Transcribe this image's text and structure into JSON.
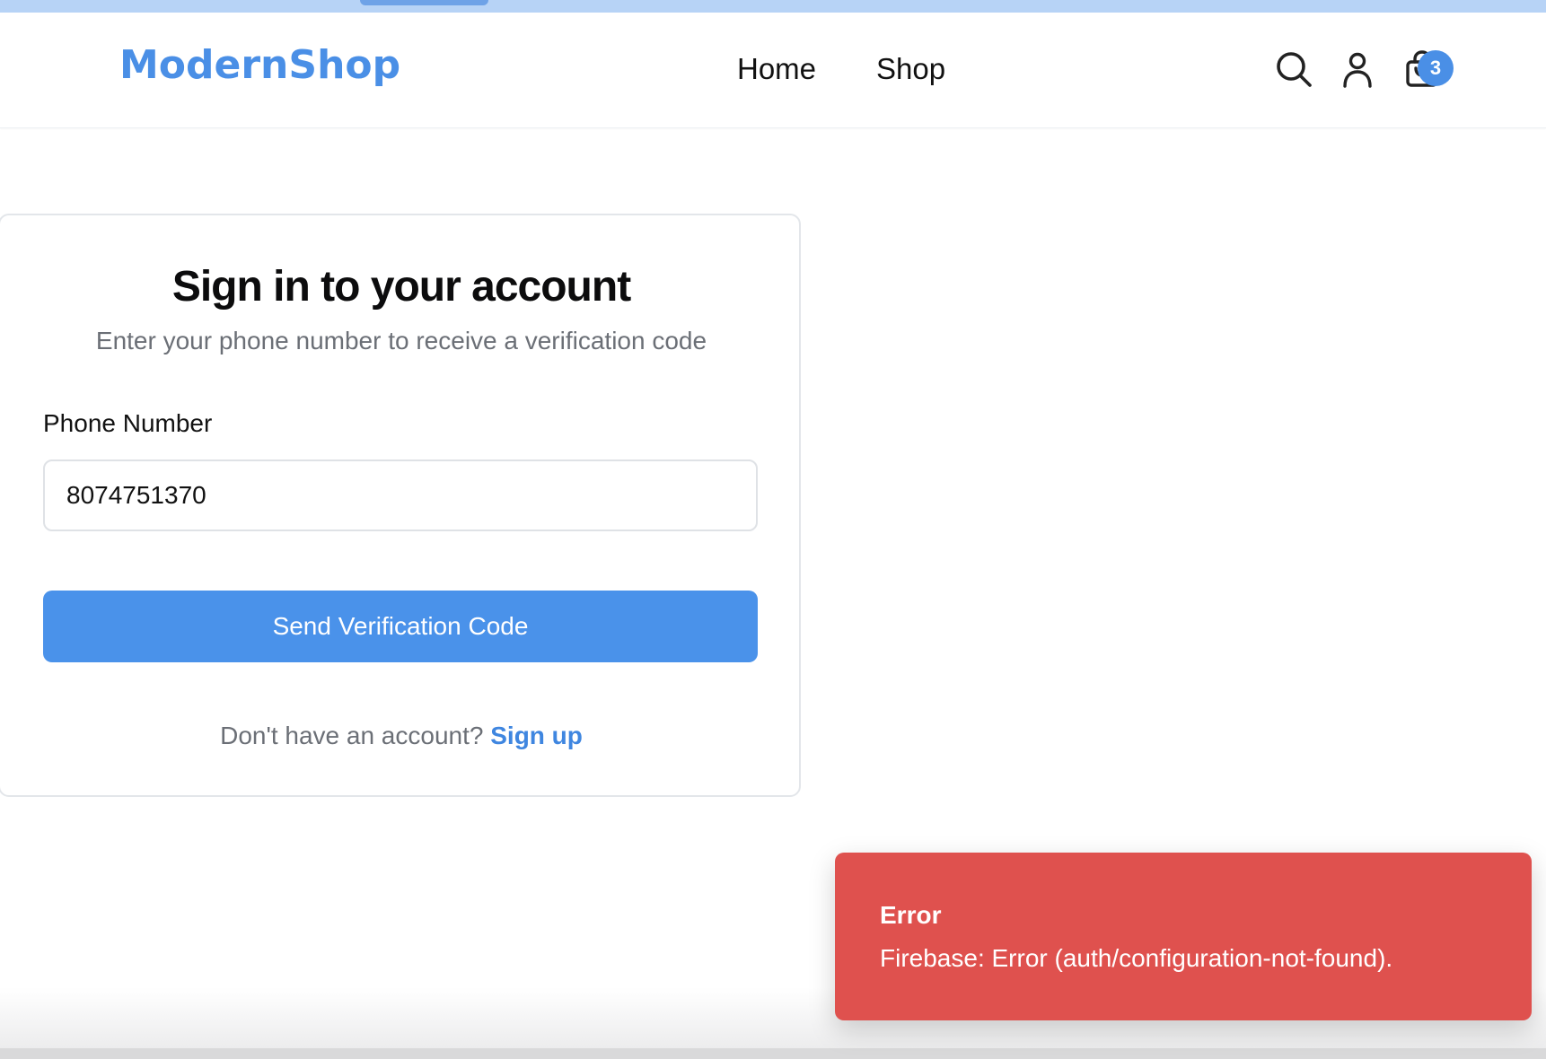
{
  "header": {
    "logo": "ModernShop",
    "nav": [
      {
        "label": "Home"
      },
      {
        "label": "Shop"
      }
    ],
    "cart_count": "3"
  },
  "login": {
    "title": "Sign in to your account",
    "subtitle": "Enter your phone number to receive a verification code",
    "phone_label": "Phone Number",
    "phone_value": "8074751370",
    "submit_label": "Send Verification Code",
    "no_account_text": "Don't have an account?",
    "signup_label": "Sign up"
  },
  "toast": {
    "title": "Error",
    "message": "Firebase: Error (auth/configuration-not-found)."
  },
  "colors": {
    "brand": "#4a8fe6",
    "primary_button": "#4a92ea",
    "error": "#df514e"
  },
  "icons": [
    "search-icon",
    "user-icon",
    "shopping-bag-icon"
  ]
}
